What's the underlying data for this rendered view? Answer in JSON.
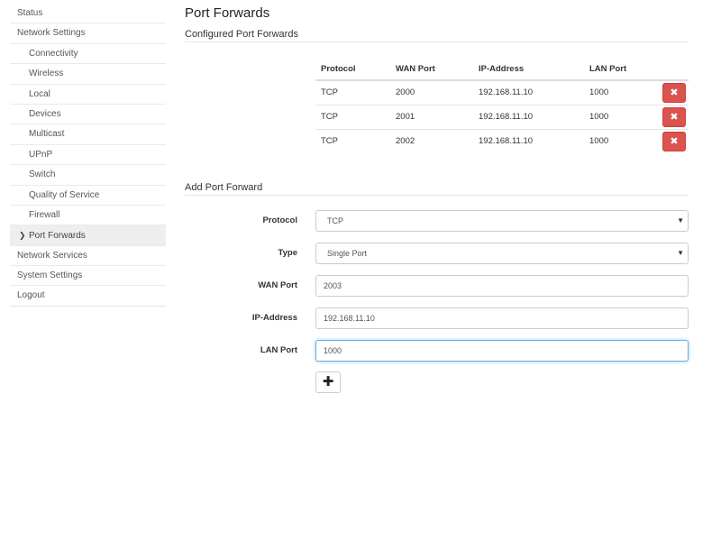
{
  "sidebar": {
    "items": [
      {
        "label": "Status"
      },
      {
        "label": "Network Settings"
      },
      {
        "label": "Connectivity"
      },
      {
        "label": "Wireless"
      },
      {
        "label": "Local"
      },
      {
        "label": "Devices"
      },
      {
        "label": "Multicast"
      },
      {
        "label": "UPnP"
      },
      {
        "label": "Switch"
      },
      {
        "label": "Quality of Service"
      },
      {
        "label": "Firewall"
      },
      {
        "label": "Port Forwards",
        "icon": "chevron-right-icon"
      },
      {
        "label": "Network Services"
      },
      {
        "label": "System Settings"
      },
      {
        "label": "Logout"
      }
    ]
  },
  "main": {
    "title": "Port Forwards",
    "configured_title": "Configured Port Forwards",
    "table": {
      "headers": [
        "Protocol",
        "WAN Port",
        "IP-Address",
        "LAN Port"
      ],
      "rows": [
        [
          "TCP",
          "2000",
          "192.168.11.10",
          "1000"
        ],
        [
          "TCP",
          "2001",
          "192.168.11.10",
          "1000"
        ],
        [
          "TCP",
          "2002",
          "192.168.11.10",
          "1000"
        ]
      ],
      "delete_icon": "close-icon",
      "delete_color": "#d9534f"
    },
    "add_title": "Add Port Forward",
    "form": {
      "protocol_label": "Protocol",
      "protocol_value": "TCP",
      "type_label": "Type",
      "type_value": "Single Port",
      "wan_label": "WAN Port",
      "wan_value": "2003",
      "ip_label": "IP-Address",
      "ip_value": "192.168.11.10",
      "lan_label": "LAN Port",
      "lan_value": "1000",
      "add_icon": "plus-icon"
    }
  }
}
